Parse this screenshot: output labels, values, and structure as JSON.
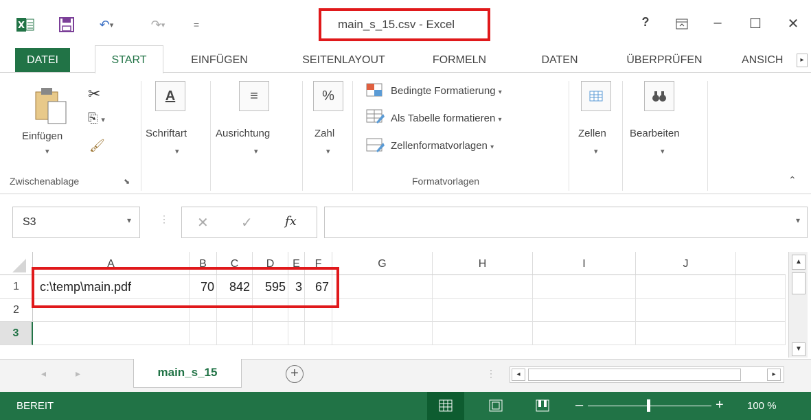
{
  "title": "main_s_15.csv - Excel",
  "qat": {
    "excel_icon": "excel-icon",
    "save_icon": "save-icon",
    "undo_icon": "undo-icon",
    "redo_icon": "redo-icon"
  },
  "window": {
    "help": "?",
    "ribbon_options": "ribbon-display-icon",
    "min": "–",
    "max": "☐",
    "close": "✕"
  },
  "tabs": [
    "DATEI",
    "START",
    "EINFÜGEN",
    "SEITENLAYOUT",
    "FORMELN",
    "DATEN",
    "ÜBERPRÜFEN",
    "ANSICH"
  ],
  "ribbon": {
    "paste": "Einfügen",
    "clipboard_group": "Zwischenablage",
    "font": "Schriftart",
    "align": "Ausrichtung",
    "number": "Zahl",
    "cond_format": "Bedingte Formatierung",
    "table_format": "Als Tabelle formatieren",
    "cell_styles": "Zellenformatvorlagen",
    "styles_group": "Formatvorlagen",
    "cells": "Zellen",
    "edit": "Bearbeiten"
  },
  "formula_bar": {
    "name_box": "S3",
    "fx": "fx",
    "value": ""
  },
  "columns": [
    "A",
    "B",
    "C",
    "D",
    "E",
    "F",
    "G",
    "H",
    "I",
    "J"
  ],
  "rows": [
    "1",
    "2",
    "3"
  ],
  "cells": {
    "A1": "c:\\temp\\main.pdf",
    "B1": "70",
    "C1": "842",
    "D1": "595",
    "E1": "3",
    "F1": "67"
  },
  "sheet_tab": "main_s_15",
  "status": {
    "ready": "BEREIT",
    "zoom": "100 %"
  },
  "accent": "#217346",
  "highlight": "#e0191b"
}
